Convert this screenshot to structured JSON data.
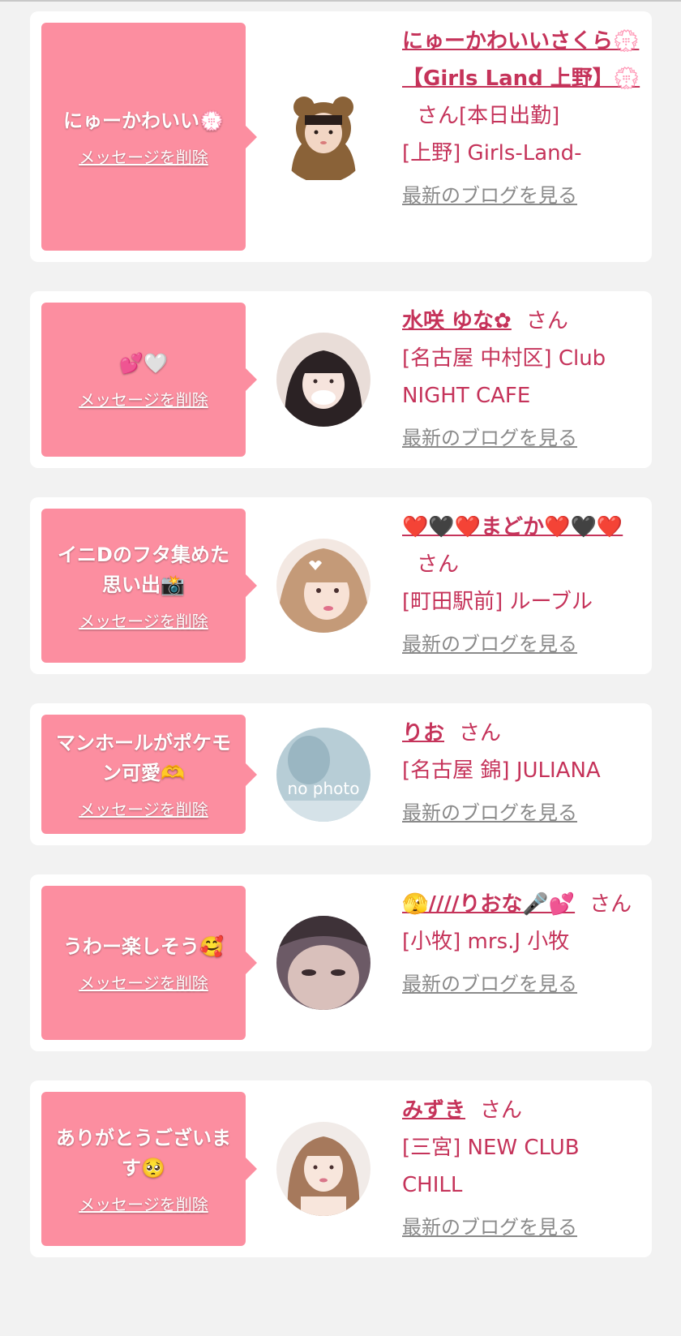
{
  "common": {
    "delete_label": "メッセージを削除",
    "blog_label": "最新のブログを見る",
    "honorific": "さん"
  },
  "cards": [
    {
      "message": "にゅーかわいい💮",
      "name": "にゅーかわいいさくら💮【Girls Land 上野】💮",
      "name_suffix": "さん[本日出勤]",
      "shop": "[上野] Girls-Land-",
      "avatar": "bear-hood"
    },
    {
      "message": "💕🤍",
      "name": "水咲 ゆな✿",
      "name_suffix": "さん",
      "shop": "[名古屋 中村区] Club NIGHT CAFE",
      "avatar": "girl-dark-hair"
    },
    {
      "message": "イニDのフタ集めた思い出📸",
      "name": "❤️🖤❤️まどか❤️🖤❤️",
      "name_suffix": "さん",
      "shop": "[町田駅前] ルーブル",
      "avatar": "girl-selfie"
    },
    {
      "message": "マンホールがポケモン可愛🫶",
      "name": "りお",
      "name_suffix": "さん",
      "shop": "[名古屋 錦] JULIANA",
      "avatar": "no-photo",
      "avatar_text": "no photo"
    },
    {
      "message": "うわー楽しそう🥰",
      "name": "🫣////りおな🎤💕",
      "name_suffix": "さん",
      "shop": "[小牧] mrs.J 小牧",
      "avatar": "girl-closeup"
    },
    {
      "message": "ありがとうございます🥺",
      "name": "みずき",
      "name_suffix": "さん",
      "shop": "[三宮] NEW CLUB CHILL",
      "avatar": "girl-brown-hair"
    }
  ]
}
